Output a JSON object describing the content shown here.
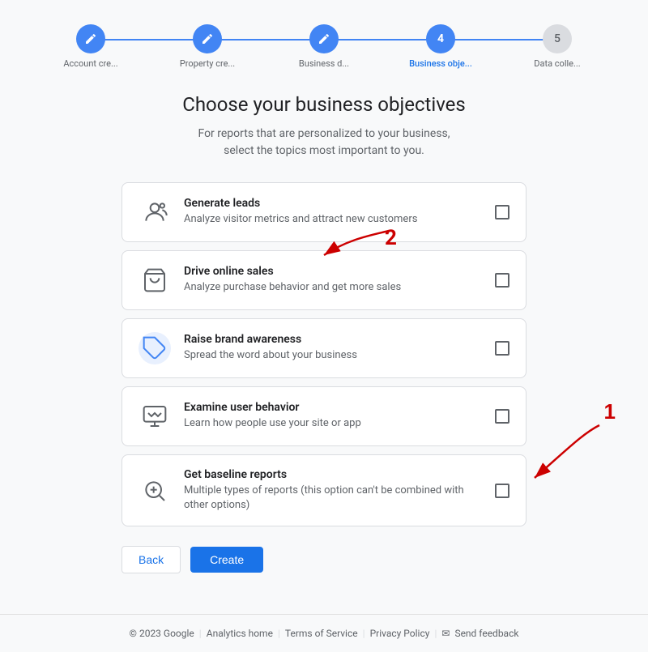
{
  "stepper": {
    "steps": [
      {
        "id": "account-creation",
        "label": "Account cre...",
        "state": "completed",
        "number": "✎"
      },
      {
        "id": "property-creation",
        "label": "Property cre...",
        "state": "completed",
        "number": "✎"
      },
      {
        "id": "business-details",
        "label": "Business d...",
        "state": "completed",
        "number": "✎"
      },
      {
        "id": "business-objectives",
        "label": "Business obje...",
        "state": "active",
        "number": "4"
      },
      {
        "id": "data-collection",
        "label": "Data colle...",
        "state": "inactive",
        "number": "5"
      }
    ]
  },
  "page": {
    "title": "Choose your business objectives",
    "subtitle": "For reports that are personalized to your business,\nselect the topics most important to you."
  },
  "options": [
    {
      "id": "generate-leads",
      "title": "Generate leads",
      "description": "Analyze visitor metrics and attract new customers",
      "icon": "leads-icon",
      "checked": false
    },
    {
      "id": "drive-online-sales",
      "title": "Drive online sales",
      "description": "Analyze purchase behavior and get more sales",
      "icon": "cart-icon",
      "checked": false
    },
    {
      "id": "raise-brand-awareness",
      "title": "Raise brand awareness",
      "description": "Spread the word about your business",
      "icon": "tag-icon",
      "checked": false
    },
    {
      "id": "examine-user-behavior",
      "title": "Examine user behavior",
      "description": "Learn how people use your site or app",
      "icon": "behavior-icon",
      "checked": false
    },
    {
      "id": "get-baseline-reports",
      "title": "Get baseline reports",
      "description": "Multiple types of reports (this option can't be combined with other options)",
      "icon": "baseline-icon",
      "checked": false
    }
  ],
  "buttons": {
    "back": "Back",
    "create": "Create"
  },
  "footer": {
    "copyright": "© 2023 Google",
    "analytics_home": "Analytics home",
    "terms": "Terms of Service",
    "privacy": "Privacy Policy",
    "send_feedback": "Send feedback"
  }
}
